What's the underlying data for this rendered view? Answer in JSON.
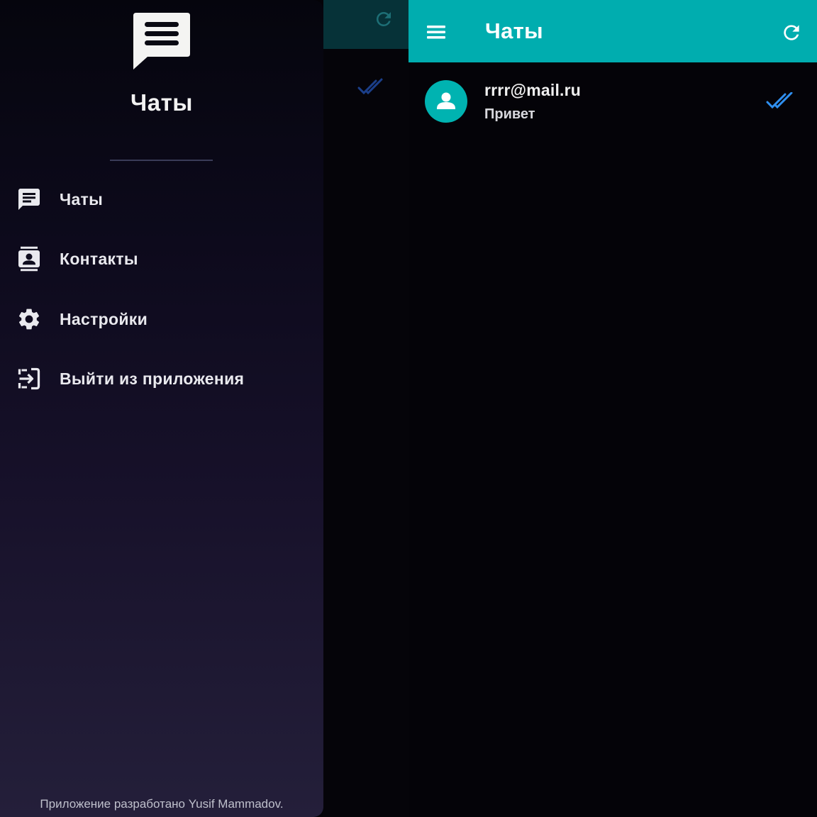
{
  "drawer": {
    "title": "Чаты",
    "logo_icon": "chat-bubble-menu-icon",
    "items": [
      {
        "label": "Чаты",
        "icon": "chat-icon"
      },
      {
        "label": "Контакты",
        "icon": "contacts-icon"
      },
      {
        "label": "Настройки",
        "icon": "gear-icon"
      },
      {
        "label": "Выйти из приложения",
        "icon": "exit-icon"
      }
    ],
    "footer": "Приложение разработано Yusif Mammadov."
  },
  "appbar": {
    "title": "Чаты",
    "menu_icon": "hamburger-menu-icon",
    "refresh_icon": "refresh-icon"
  },
  "chats": [
    {
      "name": "rrrr@mail.ru",
      "last_message": "Привет",
      "avatar_icon": "person-icon",
      "status_icon": "double-check-icon"
    }
  ],
  "colors": {
    "accent": "#00adaf",
    "check": "#2f8ff0",
    "drawer_top": "#05050d",
    "drawer_bottom": "#241f3a",
    "background": "#040308"
  }
}
